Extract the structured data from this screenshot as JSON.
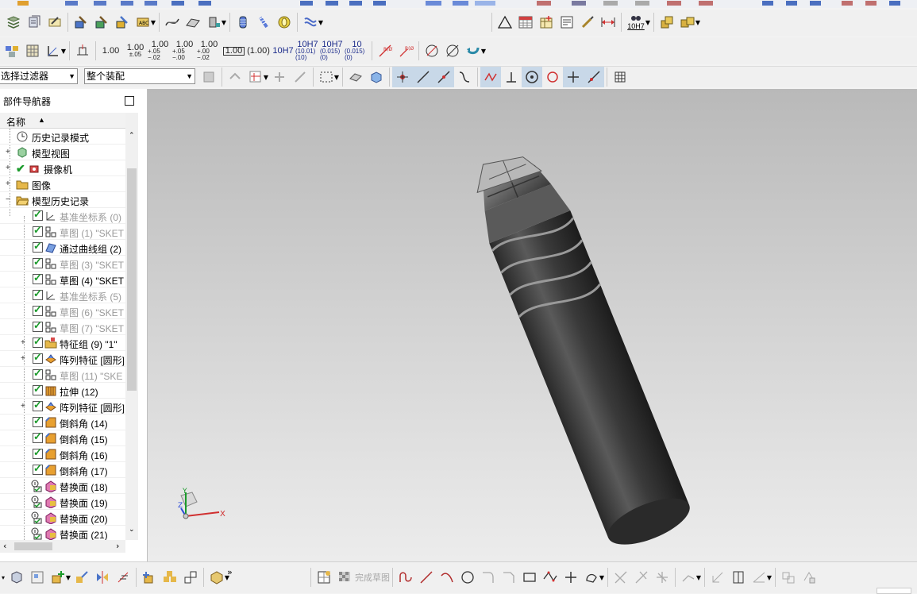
{
  "toolbar2": {
    "tolerances": [
      {
        "main": "1.00",
        "sub": ""
      },
      {
        "main": "1.00",
        "sub": "±.05"
      },
      {
        "main": "1.00",
        "sub": "+.05 −.02"
      },
      {
        "main": "1.00",
        "sub": "+.05 −.00"
      },
      {
        "main": "1.00",
        "sub": "+.00 −.02"
      },
      {
        "main": "1.00",
        "sub": ""
      },
      {
        "main": "(1.00)",
        "sub": ""
      },
      {
        "main": "10H7",
        "sub": ""
      },
      {
        "main": "10H7",
        "sub": "(10.01)(10)"
      },
      {
        "main": "10H7",
        "sub": "(0.015)(0)"
      },
      {
        "main": "10",
        "sub": "(0.015)(0)"
      }
    ],
    "fit_label": "10H7"
  },
  "filters": {
    "type_filter": "选择过滤器",
    "scope_filter": "整个装配"
  },
  "navigator": {
    "title": "部件导航器",
    "column_name": "名称",
    "items": [
      {
        "label": "历史记录模式",
        "dim": false
      },
      {
        "label": "模型视图",
        "dim": false
      },
      {
        "label": "摄像机",
        "dim": false
      },
      {
        "label": "图像",
        "dim": false
      },
      {
        "label": "模型历史记录",
        "dim": false
      },
      {
        "label": "基准坐标系 (0)",
        "dim": true
      },
      {
        "label": "草图 (1) \"SKET",
        "dim": true
      },
      {
        "label": "通过曲线组 (2)",
        "dim": false
      },
      {
        "label": "草图 (3) \"SKET",
        "dim": true
      },
      {
        "label": "草图 (4) \"SKET",
        "dim": false
      },
      {
        "label": "基准坐标系 (5)",
        "dim": true
      },
      {
        "label": "草图 (6) \"SKET",
        "dim": true
      },
      {
        "label": "草图 (7) \"SKET",
        "dim": true
      },
      {
        "label": "特征组 (9) \"1\"",
        "dim": false
      },
      {
        "label": "阵列特征 [圆形]",
        "dim": false
      },
      {
        "label": "草图 (11) \"SKE",
        "dim": true
      },
      {
        "label": "拉伸 (12)",
        "dim": false
      },
      {
        "label": "阵列特征 [圆形]",
        "dim": false
      },
      {
        "label": "倒斜角 (14)",
        "dim": false
      },
      {
        "label": "倒斜角 (15)",
        "dim": false
      },
      {
        "label": "倒斜角 (16)",
        "dim": false
      },
      {
        "label": "倒斜角 (17)",
        "dim": false
      },
      {
        "label": "替换面 (18)",
        "dim": false
      },
      {
        "label": "替换面 (19)",
        "dim": false
      },
      {
        "label": "替换面 (20)",
        "dim": false
      },
      {
        "label": "替换面 (21)",
        "dim": false
      }
    ]
  },
  "viewport": {
    "triad": {
      "x_label": "X",
      "y_label": "Y",
      "z_label": "Z"
    }
  },
  "bottombar": {
    "finish_sketch_label": "完成草图"
  },
  "colors": {
    "check_green": "#1a9a2a",
    "folder_yellow": "#e6b84a",
    "viewport_top": "#b9b9b9",
    "viewport_bottom": "#ececec"
  }
}
